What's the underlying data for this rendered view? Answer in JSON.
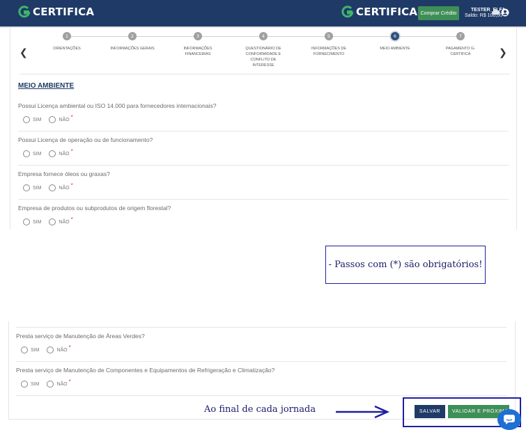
{
  "header": {
    "brand_left": "CERTIFICA",
    "brand_right": "CERTIFICA",
    "buy_credit": "Comprar Crédito",
    "user_name": "TESTER_ELFA",
    "balance": "Saldo: R$ 100,00",
    "icons": [
      "logo-icon",
      "cloud-icon",
      "user-icon"
    ]
  },
  "stepper": {
    "steps": [
      {
        "num": "1",
        "label": "ORIENTAÇÕES"
      },
      {
        "num": "2",
        "label": "INFORMAÇÕES GERAIS"
      },
      {
        "num": "3",
        "label": "INFORMAÇÕES FINANCEIRAS"
      },
      {
        "num": "4",
        "label": "QUESTIONÁRIO DE CONFORMIDADE E CONFLITO DE INTERESSE"
      },
      {
        "num": "5",
        "label": "INFORMAÇÕES DE FORNECIMENTO"
      },
      {
        "num": "6",
        "label": "MEIO AMBIENTE"
      },
      {
        "num": "7",
        "label": "PAGAMENTO G-CERTIFICA"
      }
    ],
    "active": "6"
  },
  "section": {
    "title": "MEIO AMBIENTE"
  },
  "options": {
    "yes": "SIM",
    "no": "NÃO",
    "required": "*"
  },
  "questions": [
    {
      "text": "Possui Licença ambiental ou ISO 14.000 para fornecedores internacionais?"
    },
    {
      "text": "Possui Licença de operação ou de funcionamento?"
    },
    {
      "text": "Empresa fornece óleos ou graxas?"
    },
    {
      "text": "Empresa de produtos ou subprodutos de origem florestal?"
    }
  ],
  "questions_bottom": [
    {
      "text": "Presta serviço de Manutenção de Áreas Verdes?"
    },
    {
      "text": "Presta serviço de Manutenção de Componentes e Equipamentos de Refrigeração e Climatização?"
    }
  ],
  "annotations": {
    "required_note": "- Passos com (*) são obrigatórios!",
    "bottom_note": "Ao final de cada jornada"
  },
  "actions": {
    "save": "SALVAR",
    "next": "VALIDAR E PRÓXIMO"
  },
  "colors": {
    "header": "#1f3a66",
    "green": "#3e8f57",
    "annotation": "#1f1fa0",
    "required": "#dd3333"
  }
}
